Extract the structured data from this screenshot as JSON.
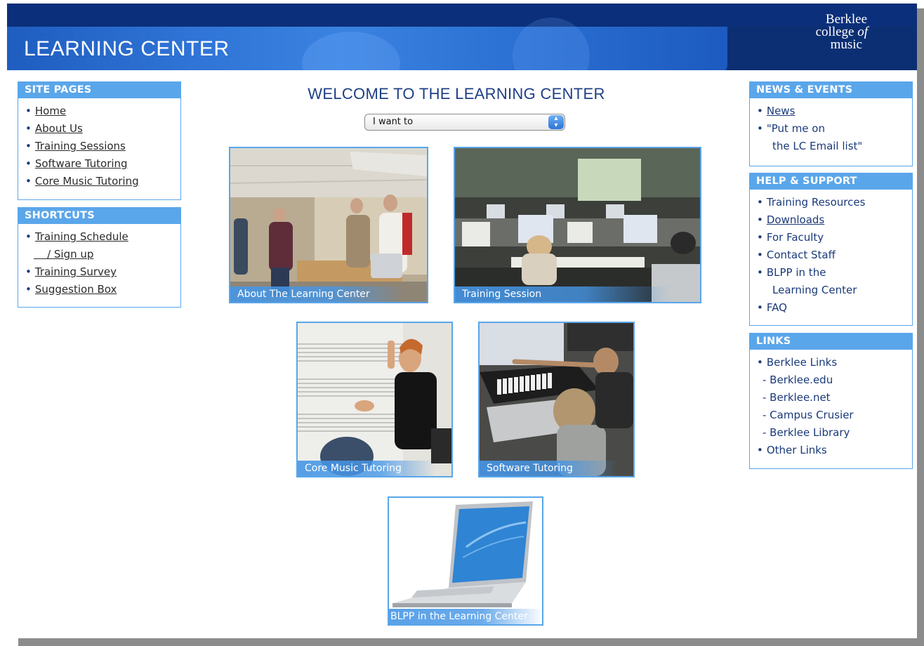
{
  "header": {
    "title": "LEARNING CENTER",
    "brand": {
      "line1": "Berklee",
      "line2a": "college",
      "line2b": "of",
      "line3": "music"
    }
  },
  "site_pages": {
    "heading": "SITE PAGES",
    "items": [
      "Home",
      "About Us",
      "Training Sessions",
      "Software Tutoring",
      "Core Music Tutoring"
    ]
  },
  "shortcuts": {
    "heading": "SHORTCUTS",
    "items": [
      "Training Schedule",
      "/ Sign up",
      "Training Survey",
      "Suggestion Box"
    ]
  },
  "main": {
    "welcome": "WELCOME TO THE LEARNING CENTER",
    "select_value": "I want to",
    "tiles": [
      "About The Learning Center",
      "Training Session",
      "Core Music Tutoring",
      "Software Tutoring",
      "BLPP in the Learning Center"
    ]
  },
  "news": {
    "heading": "NEWS & EVENTS",
    "items": [
      "News",
      "\"Put me on",
      "the LC Email list\""
    ]
  },
  "help": {
    "heading": "HELP & SUPPORT",
    "items": [
      "Training Resources",
      "Downloads",
      "For Faculty",
      "Contact Staff",
      "BLPP in the",
      "Learning Center",
      "FAQ"
    ]
  },
  "links": {
    "heading": "LINKS",
    "items": [
      "Berklee Links",
      "- Berklee.edu",
      "- Berklee.net",
      "- Campus Crusier",
      "- Berklee Library",
      "Other Links"
    ]
  },
  "colors": {
    "header_dark": "#0b2f7a",
    "header_band": "#2f74d6",
    "box_accent": "#5aa6ea",
    "link_text": "#1a3a7a"
  }
}
